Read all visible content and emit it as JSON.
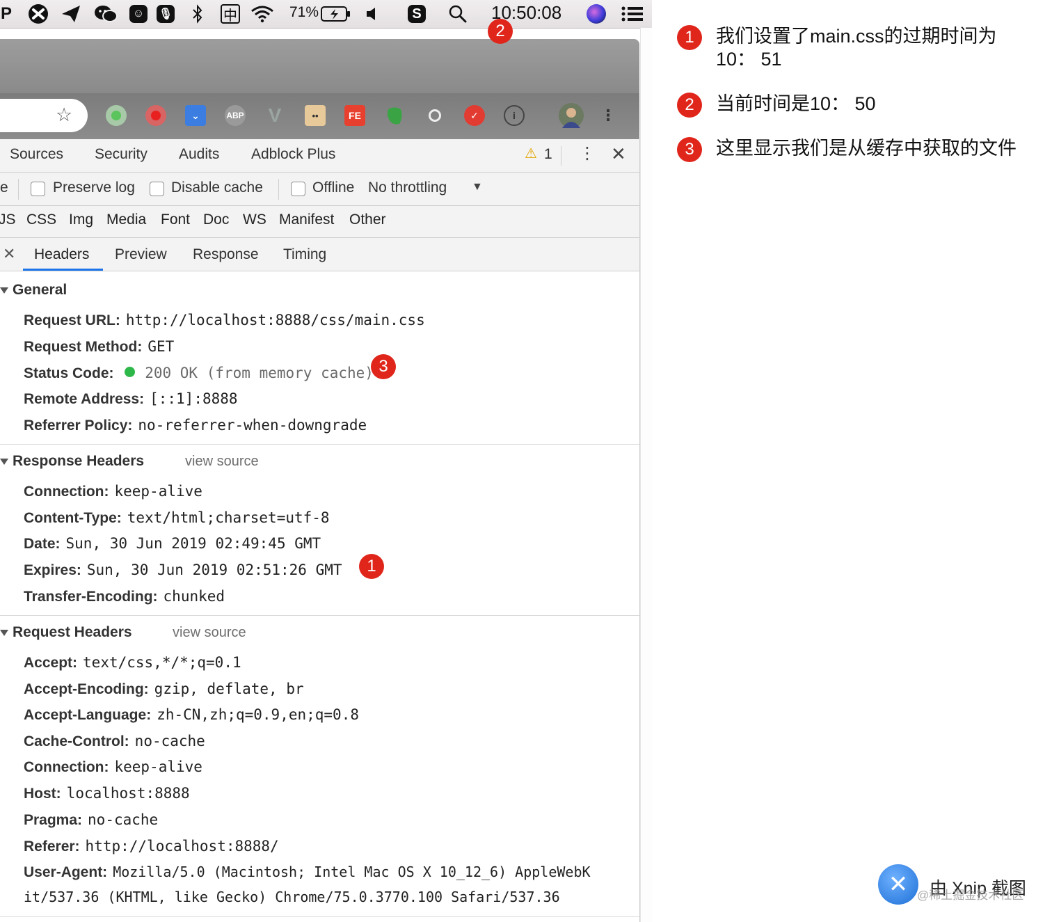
{
  "menubar": {
    "battery_percent": "71%",
    "clock": "10:50:08",
    "icons": [
      "p-icon",
      "crossover-icon",
      "paper-plane-icon",
      "wechat-icon",
      "smiley-icon",
      "microphone-icon",
      "bluetooth-icon",
      "input-method-icon",
      "wifi-icon",
      "battery-icon",
      "speaker-icon",
      "s-app-icon",
      "search-icon",
      "siri-icon",
      "list-icon"
    ],
    "input_method_char": "中"
  },
  "browser": {
    "extensions": [
      "green-dot-ext",
      "red-record-ext",
      "pocket-ext",
      "abp-ext",
      "vue-ext",
      "character-ext",
      "fe-ext",
      "evernote-ext",
      "circle-ext",
      "todoist-ext",
      "info-ext"
    ],
    "abp_label": "ABP",
    "fe_label": "FE"
  },
  "devtools": {
    "panel_tabs": [
      "Sources",
      "Security",
      "Audits",
      "Adblock Plus"
    ],
    "warning_count": "1",
    "toolbar": {
      "cut_label": "e",
      "preserve_log": "Preserve log",
      "disable_cache": "Disable cache",
      "offline": "Offline",
      "throttling": "No throttling"
    },
    "filters": [
      "JS",
      "CSS",
      "Img",
      "Media",
      "Font",
      "Doc",
      "WS",
      "Manifest",
      "Other"
    ],
    "detail_tabs": [
      "Headers",
      "Preview",
      "Response",
      "Timing"
    ],
    "general": {
      "title": "General",
      "rows": [
        {
          "key": "Request URL:",
          "value": "http://localhost:8888/css/main.css"
        },
        {
          "key": "Request Method:",
          "value": "GET"
        },
        {
          "key": "Status Code:",
          "value": "200 OK (from memory cache)"
        },
        {
          "key": "Remote Address:",
          "value": "[::1]:8888"
        },
        {
          "key": "Referrer Policy:",
          "value": "no-referrer-when-downgrade"
        }
      ]
    },
    "response_headers": {
      "title": "Response Headers",
      "view_source": "view source",
      "rows": [
        {
          "key": "Connection:",
          "value": "keep-alive"
        },
        {
          "key": "Content-Type:",
          "value": "text/html;charset=utf-8"
        },
        {
          "key": "Date:",
          "value": "Sun, 30 Jun 2019 02:49:45 GMT"
        },
        {
          "key": "Expires:",
          "value": "Sun, 30 Jun 2019 02:51:26 GMT"
        },
        {
          "key": "Transfer-Encoding:",
          "value": "chunked"
        }
      ]
    },
    "request_headers": {
      "title": "Request Headers",
      "view_source": "view source",
      "rows": [
        {
          "key": "Accept:",
          "value": "text/css,*/*;q=0.1"
        },
        {
          "key": "Accept-Encoding:",
          "value": "gzip, deflate, br"
        },
        {
          "key": "Accept-Language:",
          "value": "zh-CN,zh;q=0.9,en;q=0.8"
        },
        {
          "key": "Cache-Control:",
          "value": "no-cache"
        },
        {
          "key": "Connection:",
          "value": "keep-alive"
        },
        {
          "key": "Host:",
          "value": "localhost:8888"
        },
        {
          "key": "Pragma:",
          "value": "no-cache"
        },
        {
          "key": "Referer:",
          "value": "http://localhost:8888/"
        },
        {
          "key": "User-Agent:",
          "value": "Mozilla/5.0 (Macintosh; Intel Mac OS X 10_12_6) AppleWebK"
        }
      ],
      "user_agent_continued": "it/537.36 (KHTML, like Gecko) Chrome/75.0.3770.100 Safari/537.36"
    },
    "status_color": "#2fb84a"
  },
  "annotations": {
    "badge_color": "#e0251b",
    "badges": {
      "expires": "1",
      "clock": "2",
      "status": "3"
    },
    "notes": [
      {
        "number": "1",
        "text": "我们设置了main.css的过期时间为10： 51"
      },
      {
        "number": "2",
        "text": "当前时间是10： 50"
      },
      {
        "number": "3",
        "text": "这里显示我们是从缓存中获取的文件"
      }
    ]
  },
  "watermark": {
    "xnip": "由 Xnip 截图",
    "juejin": "@稀土掘金技术社区"
  }
}
